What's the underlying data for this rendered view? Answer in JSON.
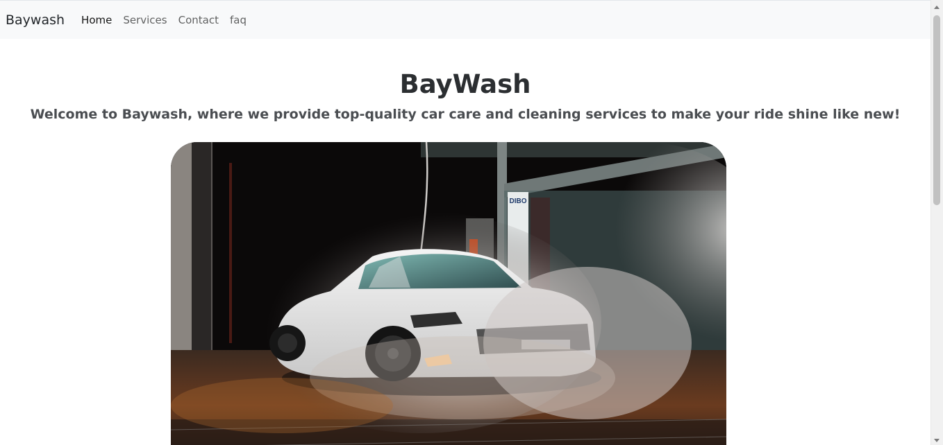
{
  "navbar": {
    "brand": "Baywash",
    "links": [
      {
        "label": "Home",
        "active": true
      },
      {
        "label": "Services",
        "active": false
      },
      {
        "label": "Contact",
        "active": false
      },
      {
        "label": "faq",
        "active": false
      }
    ]
  },
  "hero": {
    "title": "BayWash",
    "subtitle": "Welcome to Baywash, where we provide top-quality car care and cleaning services to make your ride shine like new!",
    "image_sign_text": "DIBO"
  },
  "colors": {
    "navbar_bg": "#f8f9fa",
    "title": "#2b2e31",
    "subtitle": "#4a4d51"
  }
}
